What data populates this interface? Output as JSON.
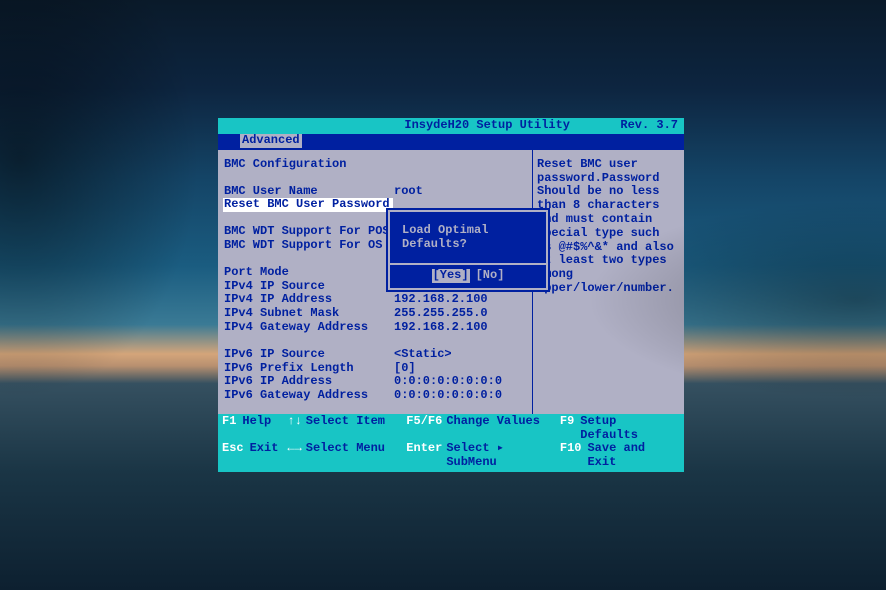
{
  "header": {
    "title": "InsydeH20 Setup Utility",
    "revision": "Rev. 3.7",
    "activeTab": "Advanced"
  },
  "panel": {
    "heading": "BMC Configuration",
    "items": [
      {
        "label": "BMC User Name",
        "value": "root"
      },
      {
        "label": "Reset BMC User Password",
        "value": "",
        "selected": true
      },
      {
        "label": "",
        "value": ""
      },
      {
        "label": "BMC WDT Support For POST",
        "value": ""
      },
      {
        "label": "BMC WDT Support For OS",
        "value": ""
      },
      {
        "label": "",
        "value": ""
      },
      {
        "label": "Port Mode",
        "value": ""
      },
      {
        "label": "IPv4 IP Source",
        "value": ""
      },
      {
        "label": "IPv4 IP Address",
        "value": "192.168.2.100"
      },
      {
        "label": "IPv4 Subnet Mask",
        "value": "255.255.255.0"
      },
      {
        "label": "IPv4 Gateway Address",
        "value": "192.168.2.100"
      },
      {
        "label": "",
        "value": ""
      },
      {
        "label": "IPv6 IP Source",
        "value": "<Static>"
      },
      {
        "label": "IPv6 Prefix Length",
        "value": "[0]"
      },
      {
        "label": "IPv6 IP Address",
        "value": "0:0:0:0:0:0:0:0"
      },
      {
        "label": "IPv6 Gateway Address",
        "value": "0:0:0:0:0:0:0:0"
      }
    ]
  },
  "help": {
    "text": "Reset BMC user password.Password Should be no less than 8 characters and must contain special type such as @#$%^&* and also at least two types among upper/lower/number."
  },
  "dialog": {
    "question": "Load Optimal Defaults?",
    "yes": "[Yes]",
    "no": "[No]"
  },
  "footer": {
    "f1": "F1",
    "f1l": "Help",
    "ud": "↑↓",
    "udl": "Select Item",
    "f5f6": "F5/F6",
    "f5f6l": "Change Values",
    "f9": "F9",
    "f9l": "Setup Defaults",
    "esc": "Esc",
    "escl": "Exit",
    "lr": "←→",
    "lrl": "Select Menu",
    "enter": "Enter",
    "enterl": "Select ▸ SubMenu",
    "f10": "F10",
    "f10l": "Save and Exit"
  }
}
